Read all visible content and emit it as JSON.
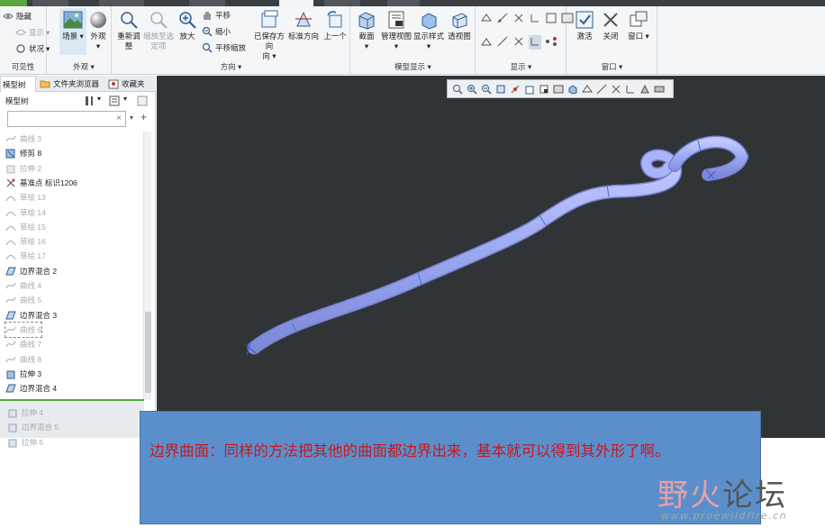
{
  "ribbon": {
    "visibility": {
      "hide": "隐藏",
      "show": "显示",
      "status": "状况",
      "group": "可见性"
    },
    "appearance": {
      "scene": "场景",
      "appearance": "外观",
      "group": "外观"
    },
    "orientation": {
      "refit": "重新调整",
      "zoom_to_selected": "缩放至选定项",
      "zoom_in": "放大",
      "pan": "平移",
      "zoom_out": "缩小",
      "pan_zoom": "平移缩放",
      "saved_orientations": "已保存方向",
      "standard_orientation": "标准方向",
      "previous": "上一个",
      "group": "方向"
    },
    "model_display": {
      "section": "截面",
      "manage_views": "管理视图",
      "display_style": "显示样式",
      "perspective": "透视图",
      "group": "模型显示"
    },
    "display": {
      "group": "显示"
    },
    "window": {
      "activate": "激活",
      "close": "关闭",
      "windows": "窗口",
      "group": "窗口"
    }
  },
  "tabs": [
    {
      "label": "模型树"
    },
    {
      "label": "文件夹浏览器"
    },
    {
      "label": "收藏夹"
    }
  ],
  "panel": {
    "title": "模型树",
    "search_value": ""
  },
  "tree": [
    {
      "label": "曲线 3",
      "dim": true,
      "icon": "curve"
    },
    {
      "label": "修剪 8",
      "dim": false,
      "icon": "trim"
    },
    {
      "label": "拉伸 2",
      "dim": true,
      "icon": "extrude"
    },
    {
      "label": "基准点 标识1206",
      "dim": false,
      "icon": "datum-point"
    },
    {
      "label": "草绘 13",
      "dim": true,
      "icon": "sketch"
    },
    {
      "label": "草绘 14",
      "dim": true,
      "icon": "sketch"
    },
    {
      "label": "草绘 15",
      "dim": true,
      "icon": "sketch"
    },
    {
      "label": "草绘 16",
      "dim": true,
      "icon": "sketch"
    },
    {
      "label": "草绘 17",
      "dim": true,
      "icon": "sketch"
    },
    {
      "label": "边界混合 2",
      "dim": false,
      "icon": "boundary"
    },
    {
      "label": "曲线 4",
      "dim": true,
      "icon": "curve"
    },
    {
      "label": "曲线 5",
      "dim": true,
      "icon": "curve"
    },
    {
      "label": "边界混合 3",
      "dim": false,
      "icon": "boundary"
    },
    {
      "label": "曲线 6",
      "dim": true,
      "icon": "curve",
      "highlight": true
    },
    {
      "label": "曲线 7",
      "dim": true,
      "icon": "curve"
    },
    {
      "label": "曲线 8",
      "dim": true,
      "icon": "curve"
    },
    {
      "label": "拉伸 3",
      "dim": false,
      "icon": "extrude"
    },
    {
      "label": "边界混合 4",
      "dim": false,
      "icon": "boundary"
    }
  ],
  "tree_lower": [
    {
      "label": "拉伸 4"
    },
    {
      "label": "边界混合 5"
    },
    {
      "label": "拉伸 5"
    }
  ],
  "caption": {
    "text": "边界曲面：同样的方法把其他的曲面都边界出来，基本就可以得到其外形了啊。"
  },
  "logo": {
    "cn_a": "野火",
    "cn_b": "论坛",
    "url": "www.proewildfire.cn"
  },
  "colors": {
    "viewport_bg": "#313437",
    "model": "#9aa7f0",
    "caption_bg": "#5b8fcc",
    "caption_text": "#c8181e"
  }
}
